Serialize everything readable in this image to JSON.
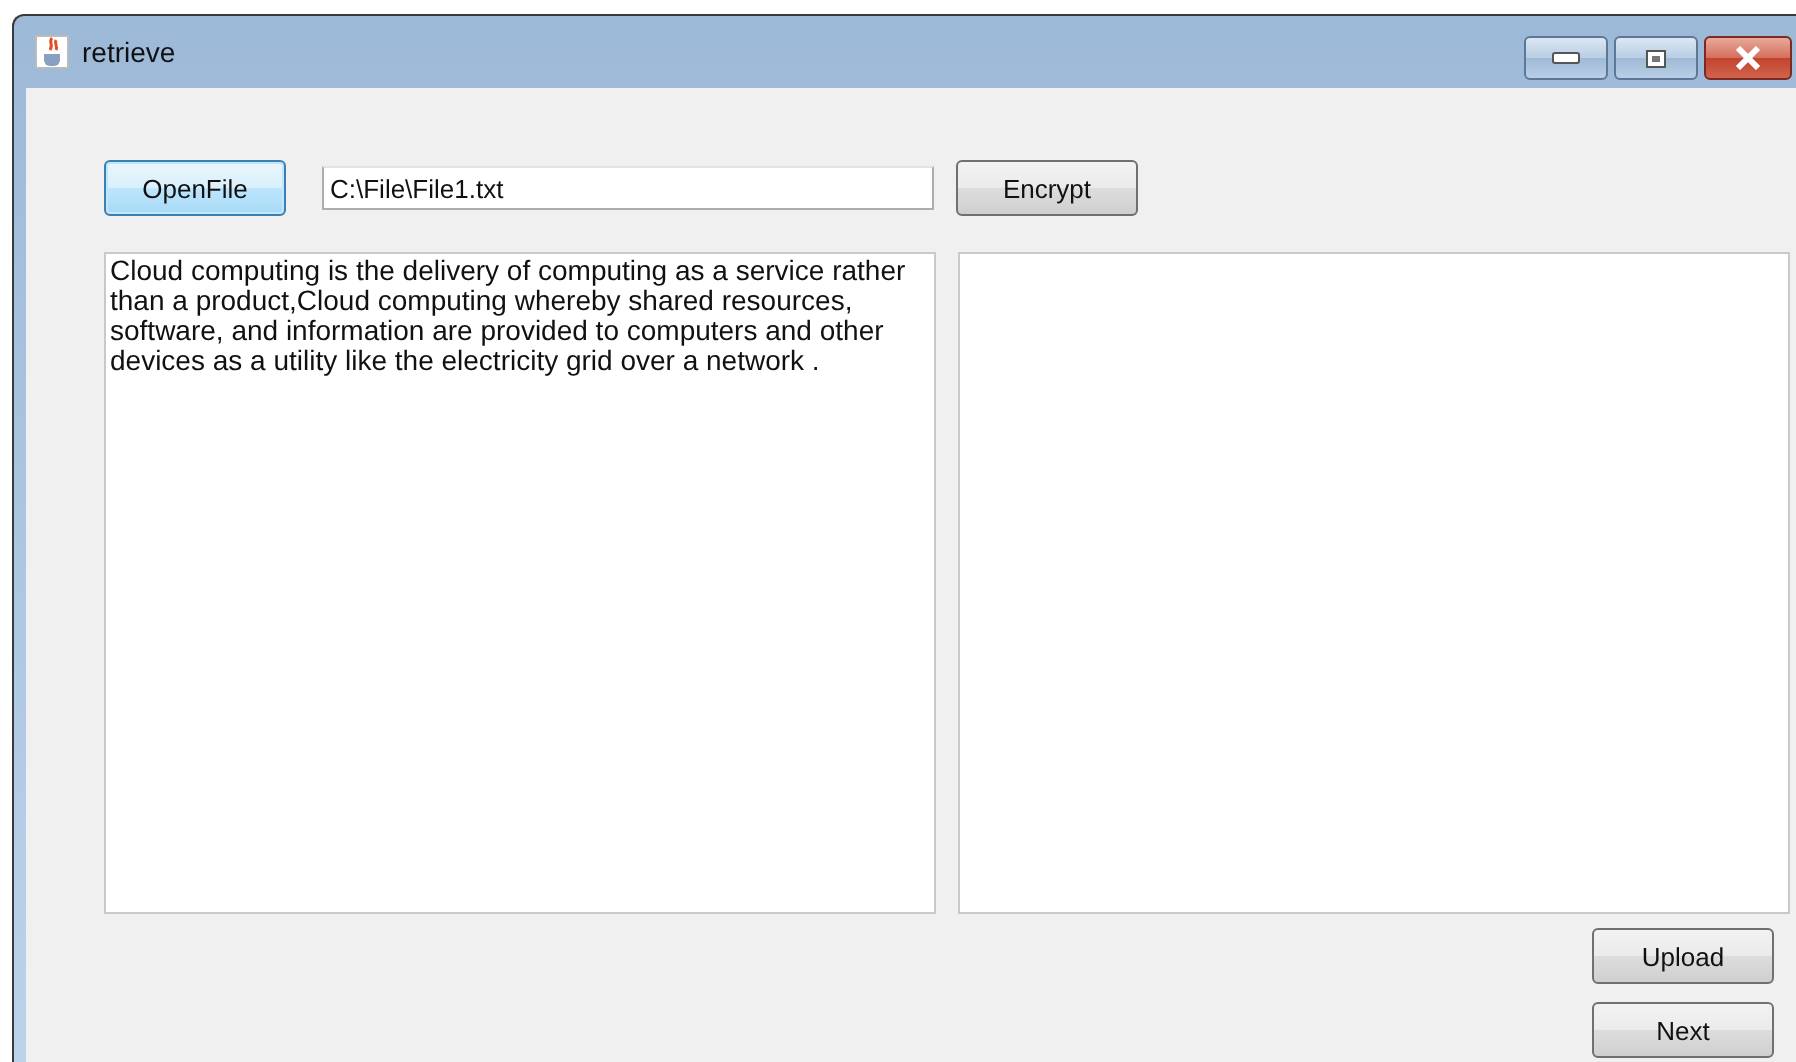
{
  "window": {
    "title": "retrieve"
  },
  "toolbar": {
    "open_button": "OpenFile",
    "path_field": {
      "value": "C:\\File\\File1.txt"
    },
    "encrypt_button": "Encrypt"
  },
  "input_text": {
    "value": "Cloud computing is the delivery of computing as a service rather than a product,Cloud computing whereby shared resources, software, and information are provided to computers and other devices as a utility like the electricity grid over a network ."
  },
  "buttons": [
    "Upload",
    "Next"
  ]
}
